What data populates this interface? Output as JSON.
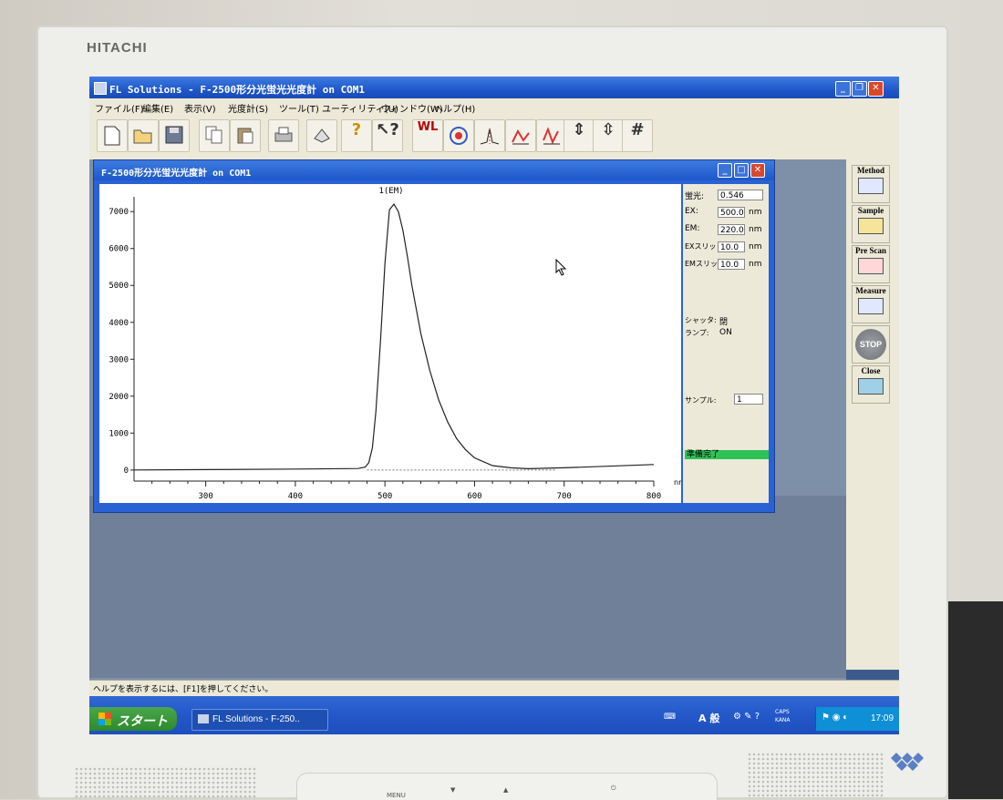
{
  "monitor": {
    "brand": "HITACHI",
    "buttons": [
      "MENU",
      "▼",
      "▲",
      "⏻"
    ]
  },
  "app": {
    "title": "FL Solutions - F-2500形分光蛍光光度計 on COM1",
    "menus": [
      "ファイル(F)",
      "編集(E)",
      "表示(V)",
      "光度計(S)",
      "ツール(T)",
      "ユーティリティ(U)",
      "ウィンドウ(W)",
      "ヘルプ(H)"
    ],
    "toolbar": [
      "new-icon",
      "open-icon",
      "save-icon",
      "copy-icon",
      "paste-icon",
      "print-icon",
      "3d-icon",
      "help-icon",
      "context-help-icon",
      "wl-icon",
      "scan-icon",
      "peak-icon",
      "baseline-icon",
      "derivative-icon",
      "scale-icon",
      "expand-icon",
      "grid-icon"
    ]
  },
  "child": {
    "title": "F-2500形分光蛍光光度計 on COM1",
    "chart_title": "1(EM)",
    "x_unit": "nm"
  },
  "chart_data": {
    "type": "line",
    "title": "1(EM)",
    "xlabel": "nm",
    "ylabel": "",
    "xlim": [
      220,
      800
    ],
    "ylim": [
      -300,
      7400
    ],
    "xticks": [
      300,
      400,
      500,
      600,
      700,
      800
    ],
    "yticks": [
      0,
      1000,
      2000,
      3000,
      4000,
      5000,
      6000,
      7000
    ],
    "series": [
      {
        "x": [
          220,
          300,
          400,
          470,
          478,
          482,
          486,
          490,
          495,
          500,
          505,
          510,
          515,
          520,
          525,
          530,
          540,
          550,
          560,
          570,
          580,
          590,
          600,
          620,
          640,
          660,
          700,
          800
        ],
        "values": [
          0,
          10,
          25,
          40,
          80,
          200,
          600,
          1600,
          3500,
          5600,
          7050,
          7200,
          7000,
          6500,
          5800,
          5000,
          3700,
          2700,
          1900,
          1300,
          850,
          550,
          330,
          120,
          60,
          35,
          60,
          150
        ]
      }
    ],
    "baseline": 0,
    "grid": false
  },
  "info": {
    "fluor_label": "蛍光:",
    "fluor_value": "0.546",
    "ex_label": "EX:",
    "ex_value": "500.0",
    "ex_unit": "nm",
    "em_label": "EM:",
    "em_value": "220.0",
    "em_unit": "nm",
    "exslit_label": "EXスリット:",
    "exslit_value": "10.0",
    "exslit_unit": "nm",
    "emslit_label": "EMスリット:",
    "emslit_value": "10.0",
    "emslit_unit": "nm",
    "shutter_label": "シャッタ:",
    "shutter_value": "閉",
    "lamp_label": "ランプ:",
    "lamp_value": "ON",
    "sample_label": "サンプル:",
    "sample_value": "1",
    "status": "準備完了"
  },
  "side": {
    "method": "Method",
    "sample": "Sample",
    "prescan": "Pre Scan",
    "measure": "Measure",
    "stop": "STOP",
    "close": "Close"
  },
  "statusbar": {
    "text": "ヘルプを表示するには、[F1]を押してください。"
  },
  "taskbar": {
    "start": "スタート",
    "task": "FL Solutions - F-250..",
    "time": "17:09",
    "ime": "A 般",
    "caps": "CAPS",
    "kana": "KANA"
  }
}
